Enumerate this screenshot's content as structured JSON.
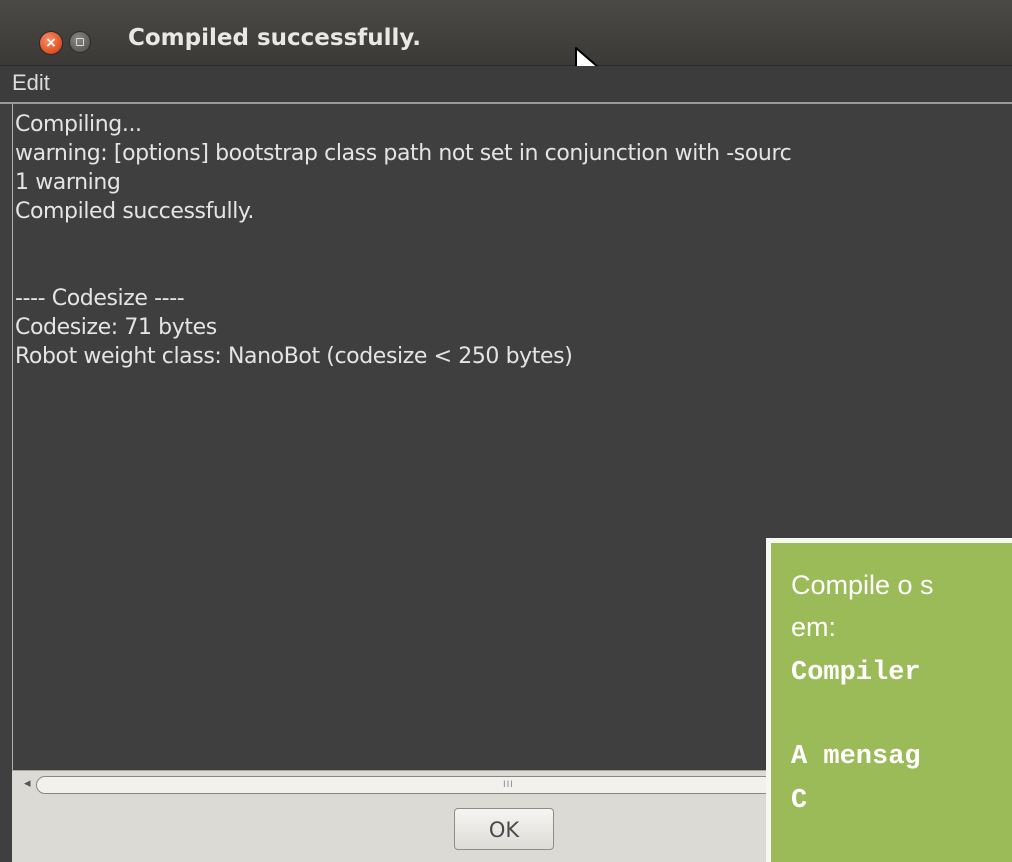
{
  "window": {
    "title": "Compiled successfully.",
    "close_glyph": "×",
    "colors": {
      "background": "#3f3f3f",
      "text": "#e4e4e4",
      "close_button": "#e4572a"
    }
  },
  "menu": {
    "edit_label": "Edit"
  },
  "output": {
    "lines": [
      "Compiling...",
      "warning: [options] bootstrap class path not set in conjunction with -sourc",
      "1 warning",
      "Compiled successfully.",
      "",
      "",
      "---- Codesize ----",
      "Codesize: 71 bytes",
      "Robot weight class: NanoBot  (codesize < 250 bytes)"
    ]
  },
  "scrollbar": {
    "left_arrow": "◂",
    "grip": "III"
  },
  "buttons": {
    "ok_label": "OK"
  },
  "overlay": {
    "background_color": "#9bbb59",
    "line1": "Compile o s",
    "line2": "em:",
    "line3": "Compiler",
    "line4": "A mensag",
    "line5": "C"
  }
}
